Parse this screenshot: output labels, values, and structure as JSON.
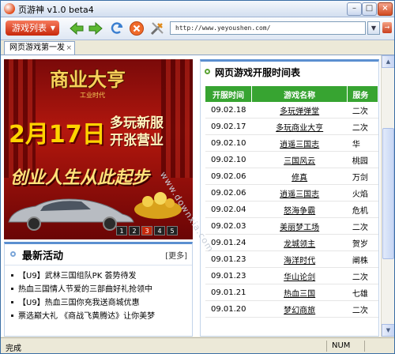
{
  "window": {
    "title": "页游神 v1.0 beta4"
  },
  "toolbar": {
    "menu_label": "游戏列表",
    "address": "http://www.yeyoushen.com/"
  },
  "tabs": [
    {
      "label": "网页游戏第一发"
    }
  ],
  "banner": {
    "logo": "商业大亨",
    "logo_sub": "工业时代",
    "date": "2月17日",
    "promo_line1": "多玩新服",
    "promo_line2": "开张营业",
    "slogan": "创业人生从此起步",
    "slides": [
      "1",
      "2",
      "3",
      "4",
      "5"
    ]
  },
  "news": {
    "title": "最新活动",
    "more": "[更多]",
    "items": [
      "【U9】武林三国组队PK 荟势待发",
      "热血三国情人节爱的三部曲好礼抢领中",
      "【U9】热血三国你充我送商城优惠",
      "票选巅大礼 《商战飞黄腾达》让你美梦"
    ]
  },
  "schedule": {
    "title": "网页游戏开服时间表",
    "columns": [
      "开服时间",
      "游戏名称",
      "服务"
    ],
    "rows": [
      {
        "date": "09.02.18",
        "game": "多玩弹弹堂",
        "server": "二次"
      },
      {
        "date": "09.02.17",
        "game": "多玩商业大亨",
        "server": "二次"
      },
      {
        "date": "09.02.10",
        "game": "逍遥三国志",
        "server": "华"
      },
      {
        "date": "09.02.10",
        "game": "三国风云",
        "server": "桃园"
      },
      {
        "date": "09.02.06",
        "game": "修真",
        "server": "万剑"
      },
      {
        "date": "09.02.06",
        "game": "逍遥三国志",
        "server": "火焰"
      },
      {
        "date": "09.02.04",
        "game": "怒海争霸",
        "server": "危机"
      },
      {
        "date": "09.02.03",
        "game": "美丽梦工场",
        "server": "二次"
      },
      {
        "date": "09.01.24",
        "game": "龙城领主",
        "server": "贺岁"
      },
      {
        "date": "09.01.23",
        "game": "海洋时代",
        "server": "阐株"
      },
      {
        "date": "09.01.23",
        "game": "华山论剑",
        "server": "二次"
      },
      {
        "date": "09.01.21",
        "game": "热血三国",
        "server": "七雄"
      },
      {
        "date": "09.01.20",
        "game": "梦幻商旅",
        "server": "二次"
      }
    ]
  },
  "watermark": "www.downxia.com",
  "status": {
    "text": "完成",
    "num": "NUM"
  },
  "colors": {
    "table_header": "#37a431",
    "menu_button": "#c8280a",
    "accent_border": "#5b8fd0"
  }
}
